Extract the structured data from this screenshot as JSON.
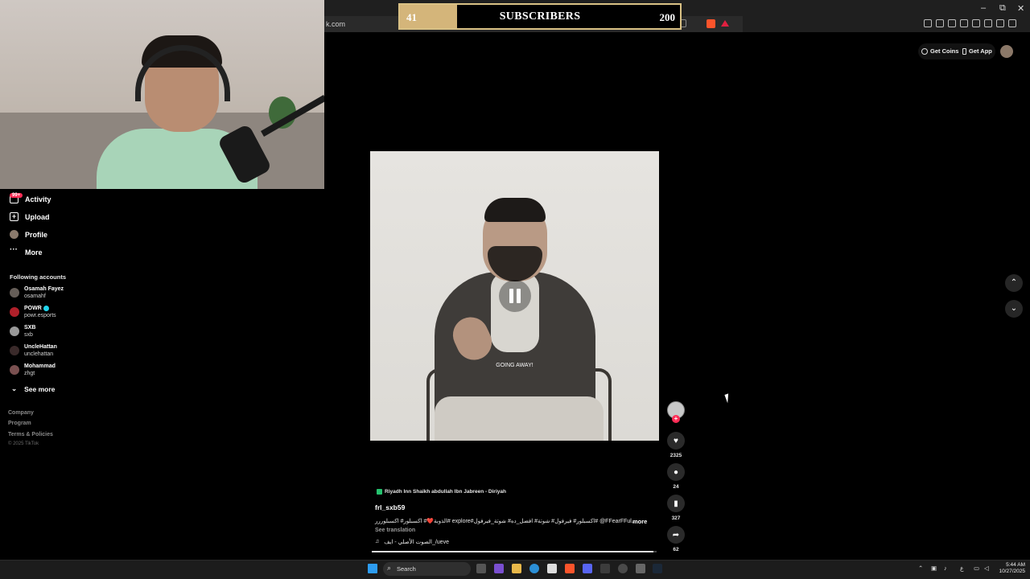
{
  "browser": {
    "url_fragment": "k.com",
    "controls": [
      "–",
      "⧉",
      "✕"
    ]
  },
  "overlay": {
    "current": "41",
    "label": "SUBSCRIBERS",
    "goal": "200",
    "progress_fraction": 0.205
  },
  "sidebar": {
    "badge": "99+",
    "nav": [
      {
        "label": "Activity",
        "icon": "activity-icon"
      },
      {
        "label": "Upload",
        "icon": "upload-icon"
      },
      {
        "label": "Profile",
        "icon": "profile-icon"
      },
      {
        "label": "More",
        "icon": "more-icon"
      }
    ],
    "following_title": "Following accounts",
    "accounts": [
      {
        "name": "Osamah Fayez",
        "user": "osamahf"
      },
      {
        "name": "POWR",
        "user": "powr.esports",
        "verified": true
      },
      {
        "name": "SXB",
        "user": "sxb"
      },
      {
        "name": "UncleHattan",
        "user": "unclehattan"
      },
      {
        "name": "Mohammad",
        "user": "zhgt"
      }
    ],
    "see_more": "See more",
    "footer": [
      "Company",
      "Program",
      "Terms & Policies"
    ],
    "copyright": "© 2025 TikTok"
  },
  "header": {
    "get_coins": "Get Coins",
    "get_app": "Get App"
  },
  "video": {
    "caption_overlay": "GOING AWAY!",
    "state": "playing",
    "progress_fraction": 0.99
  },
  "actions": {
    "likes": "2325",
    "comments": "24",
    "saves": "327",
    "shares": "62"
  },
  "post": {
    "location": "Riyadh Inn Shaikh abdullah Ibn Jabreen - Diriyah",
    "author": "frl_sxb59",
    "description": "الذوبة❤️# اكسبلور# اكسبلوررر# explore#اكسبلور# فيرفول# شوتة# افضل_ده# شوتة_فيرفول# @FFearFFul...",
    "more": "more",
    "see_translation": "See translation",
    "sound_icon": "♫",
    "sound": "الصوت الأصلي - ايف_/ueve"
  },
  "taskbar": {
    "search_placeholder": "Search",
    "lang": "ع",
    "time": "5:44 AM",
    "date": "10/27/2025"
  },
  "colors": {
    "accent": "#fe2c55",
    "overlay_gold": "#d4b57a",
    "background": "#000000"
  }
}
